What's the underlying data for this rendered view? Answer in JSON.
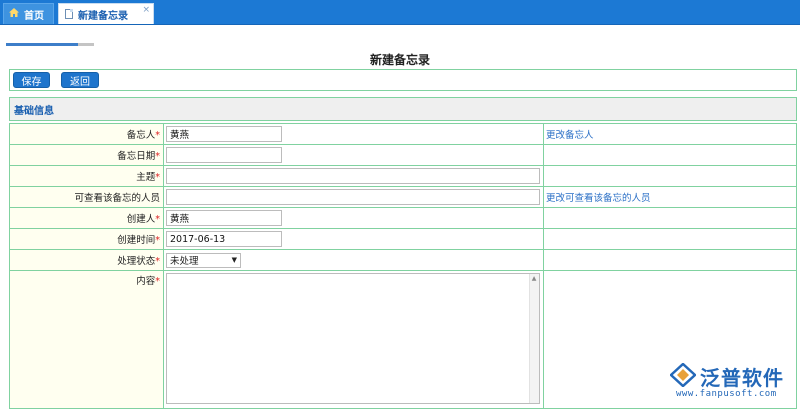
{
  "tabs": [
    {
      "label": "首页",
      "icon": "home-icon"
    },
    {
      "label": "新建备忘录",
      "icon": "document-icon",
      "close": "×"
    }
  ],
  "progress": {
    "fraction": 0.82
  },
  "page_title": "新建备忘录",
  "toolbar": {
    "save_label": "保存",
    "back_label": "返回"
  },
  "section": {
    "title": "基础信息"
  },
  "required_mark": "*",
  "form": {
    "owner": {
      "label": "备忘人",
      "value": "黄燕",
      "action": "更改备忘人"
    },
    "memo_date": {
      "label": "备忘日期",
      "value": ""
    },
    "subject": {
      "label": "主题",
      "value": ""
    },
    "viewers": {
      "label": "可查看该备忘的人员",
      "value": "",
      "action": "更改可查看该备忘的人员"
    },
    "creator": {
      "label": "创建人",
      "value": "黄燕"
    },
    "created_time": {
      "label": "创建时间",
      "value": "2017-06-13"
    },
    "status": {
      "label": "处理状态",
      "value": "未处理"
    },
    "content": {
      "label": "内容",
      "value": ""
    }
  },
  "watermark": {
    "name": "泛普软件",
    "url": "www.fanpusoft.com"
  },
  "colors": {
    "tabbar": "#1c79d4",
    "button": "#1e74cc",
    "border": "#80d2a0",
    "link": "#2a6fc6",
    "required": "#dd2222"
  }
}
